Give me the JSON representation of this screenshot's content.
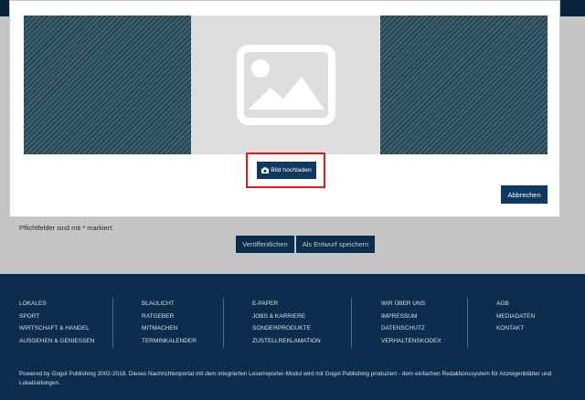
{
  "modal": {
    "upload_label": "Bild hochladen",
    "cancel_label": "Abbrechen"
  },
  "form": {
    "required_note": "Pflichtfelder sind mit * markiert.",
    "publish_label": "Veröffentlichen",
    "draft_label": "Als Entwurf speichern"
  },
  "footer": {
    "columns": [
      [
        "LOKALES",
        "SPORT",
        "WIRTSCHAFT & HANDEL",
        "AUSGEHEN & GENIESSEN"
      ],
      [
        "BLAULICHT",
        "RATGEBER",
        "MITMACHEN",
        "TERMINKALENDER"
      ],
      [
        "E-PAPER",
        "JOBS & KARRIERE",
        "SONDERPRODUKTE",
        "ZUSTELLREKLAMATION"
      ],
      [
        "WIR ÜBER UNS",
        "IMPRESSUM",
        "DATENSCHUTZ",
        "VERHALTENSKODEX"
      ],
      [
        "AGB",
        "MEDIADATEN",
        "KONTAKT"
      ]
    ],
    "copyright": "Powered by Gogol Publishing 2002-2018. Dieses Nachrichtenportal mit dem integrierten Leserreporter-Modul wird mit Gogol Publishing produziert - dem einfachen Redaktionssystem für Anzeigenblätter und Lokalzeitungen."
  },
  "colors": {
    "navy": "#0e3a62",
    "footer_bg": "#0c2d4d",
    "highlight": "#e11a1a"
  },
  "icons": {
    "placeholder": "image-placeholder-icon",
    "upload": "camera-icon"
  }
}
